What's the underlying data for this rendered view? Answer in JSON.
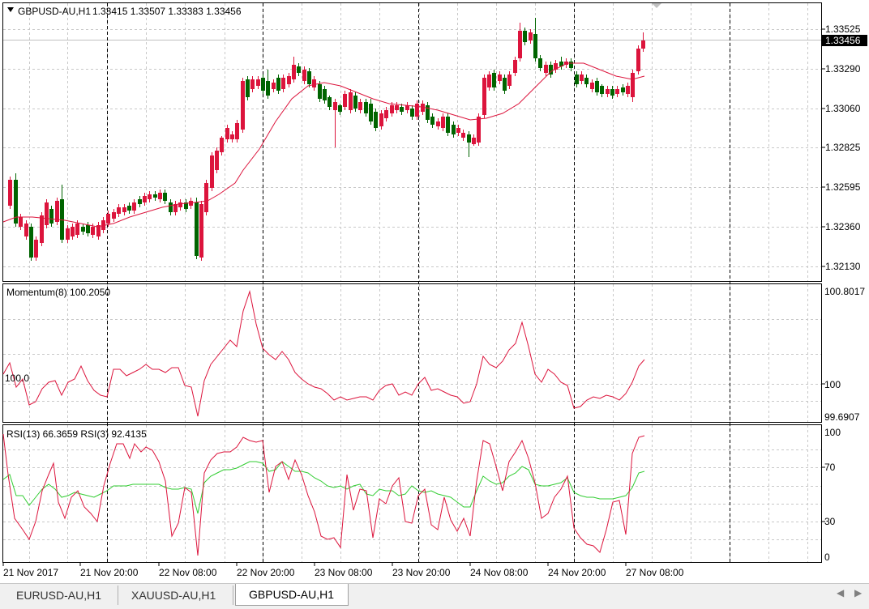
{
  "main_chart": {
    "symbol_label": "GBPUSD-AU,H1",
    "ohlc_label": "1.33415 1.33507 1.33383 1.33456",
    "current_price": "1.33456",
    "price_ticks": [
      "1.33525",
      "1.33290",
      "1.33060",
      "1.32825",
      "1.32595",
      "1.32360",
      "1.32130"
    ],
    "bull_color": "#006400",
    "bear_color": "#dc143c",
    "ma_color": "#dc143c"
  },
  "momentum": {
    "label": "Momentum(8) 100.2050",
    "level_label": "100.0",
    "ticks": [
      "100.8017",
      "100",
      "99.6907"
    ],
    "line_color": "#dc143c"
  },
  "rsi": {
    "label": "RSI(13) 66.3659  RSI(3) 92.4135",
    "ticks": [
      "100",
      "70",
      "30",
      "0"
    ],
    "rsi13_color": "#32cd32",
    "rsi3_color": "#dc143c"
  },
  "time_axis": {
    "labels": [
      "21 Nov 2017",
      "21 Nov 20:00",
      "22 Nov 08:00",
      "22 Nov 20:00",
      "23 Nov 08:00",
      "23 Nov 20:00",
      "24 Nov 08:00",
      "24 Nov 20:00",
      "27 Nov 08:00"
    ]
  },
  "tabs": [
    {
      "label": "EURUSD-AU,H1",
      "active": false
    },
    {
      "label": "XAUUSD-AU,H1",
      "active": false
    },
    {
      "label": "GBPUSD-AU,H1",
      "active": true
    }
  ],
  "nav": {
    "left_icon": "scroll-left-icon",
    "right_icon": "scroll-right-icon"
  }
}
